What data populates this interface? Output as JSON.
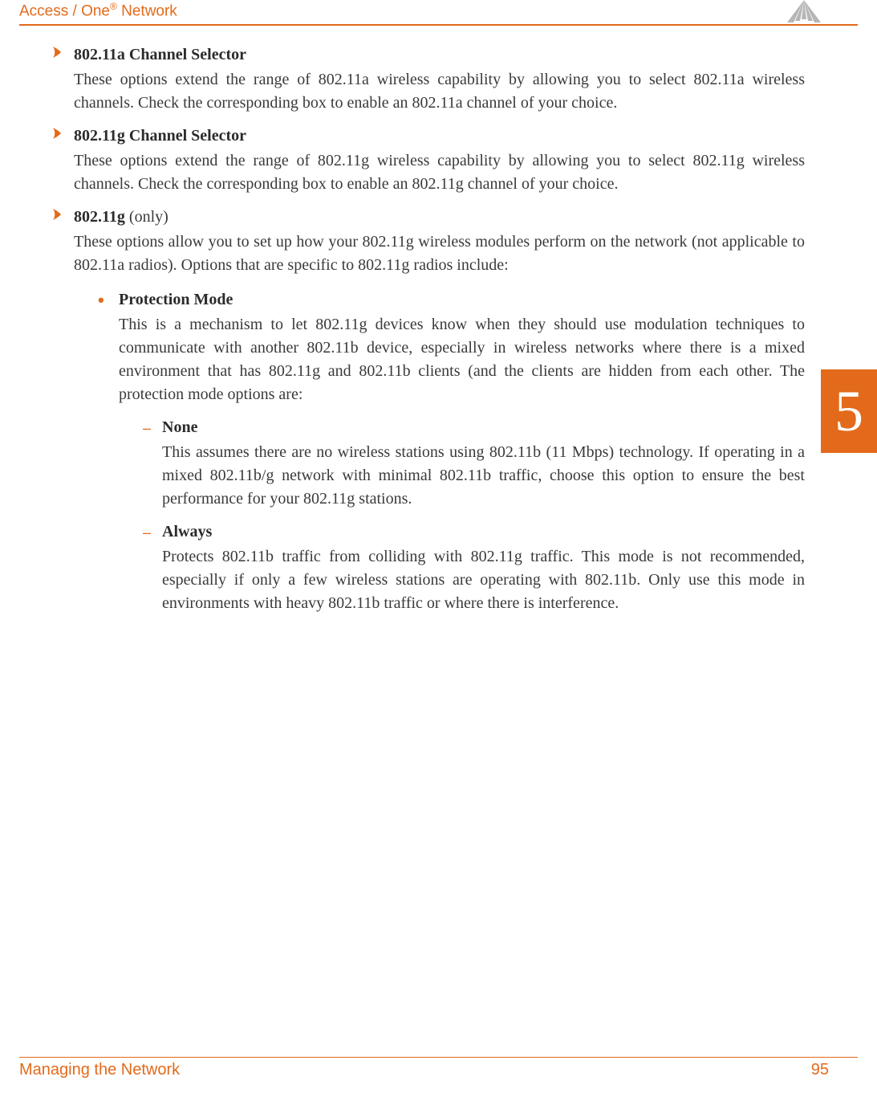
{
  "header": {
    "product": "Access / One",
    "reg": "®",
    "suffix": " Network"
  },
  "chapterTab": "5",
  "items": [
    {
      "title": "802.11a Channel Selector",
      "title_suffix": "",
      "text": "These options extend the range of 802.11a wireless capability by allowing you to select 802.11a wireless channels. Check the corresponding box to enable an 802.11a channel of your choice."
    },
    {
      "title": "802.11g Channel Selector",
      "title_suffix": "",
      "text": "These options extend the range of 802.11g wireless capability by allowing you to select 802.11g wireless channels. Check the corresponding box to enable an 802.11g channel of your choice."
    },
    {
      "title": "802.11g",
      "title_suffix": " (only)",
      "text": "These options allow you to set up how your 802.11g wireless modules perform on the network (not applicable to 802.11a radios). Options that are specific to 802.11g radios include:"
    }
  ],
  "subItems": [
    {
      "title": "Protection Mode",
      "text": "This is a mechanism to let 802.11g devices know when they should use modulation techniques to communicate with another 802.11b device, especially in wireless networks where there is a mixed environment that has 802.11g and 802.11b clients (and the clients are hidden from each other. The protection mode options are:"
    }
  ],
  "dashItems": [
    {
      "title": "None",
      "text": "This assumes there are no wireless stations using 802.11b (11 Mbps) technology. If operating in a mixed 802.11b/g network with minimal 802.11b traffic, choose this option to ensure the best performance for your 802.11g stations."
    },
    {
      "title": "Always",
      "text": "Protects 802.11b traffic from colliding with 802.11g traffic. This mode is not recommended, especially if only a few wireless stations are operating with 802.11b. Only use this mode in environments with heavy 802.11b traffic or where there is interference."
    }
  ],
  "footer": {
    "section": "Managing the Network",
    "page": "95"
  }
}
